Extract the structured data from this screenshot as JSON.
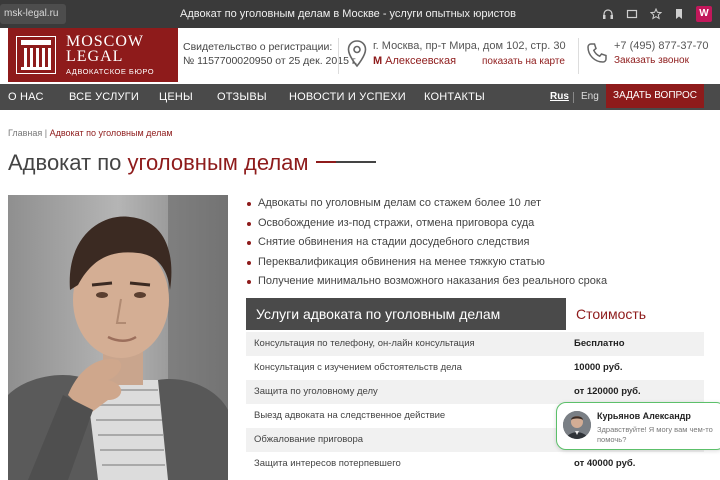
{
  "browser": {
    "url": "msk-legal.ru",
    "title": "Адвокат по уголовным делам в Москве - услуги опытных юристов",
    "extension_badge": "W"
  },
  "header": {
    "logo_line1": "MOSCOW",
    "logo_line2": "LEGAL",
    "logo_sub": "АДВОКАТСКОЕ БЮРО",
    "cert_line1": "Свидетельство о регистрации:",
    "cert_line2": "№ 1157700020950 от 25 дек. 2015 г.",
    "address": "г. Москва, пр-т Мира, дом 102, стр. 30",
    "metro_mark": "М",
    "metro": "Алексеевская",
    "map_link": "показать на карте",
    "phone": "+7 (495) 877-37-70",
    "callback": "Заказать звонок"
  },
  "nav": {
    "items": [
      "О НАС",
      "ВСЕ УСЛУГИ",
      "ЦЕНЫ",
      "ОТЗЫВЫ",
      "НОВОСТИ И УСПЕХИ",
      "КОНТАКТЫ"
    ],
    "lang_ru": "Rus",
    "lang_en": "Eng",
    "ask_button": "ЗАДАТЬ ВОПРОС"
  },
  "breadcrumb": {
    "home": "Главная",
    "sep": " | ",
    "current": "Адвокат по уголовным делам"
  },
  "heading": {
    "part1": "Адвокат по ",
    "part2": "уголовным делам"
  },
  "bullets": [
    "Адвокаты по уголовным делам со стажем более 10 лет",
    "Освобождение из-под стражи, отмена приговора суда",
    "Снятие обвинения на стадии досудебного следствия",
    "Переквалификация обвинения на менее тяжкую статью",
    "Получение минимально возможного наказания без реального срока"
  ],
  "services": {
    "title": "Услуги адвоката по уголовным делам",
    "cost_header": "Стоимость",
    "rows": [
      {
        "service": "Консультация по телефону, он-лайн консультация",
        "price": "Бесплатно"
      },
      {
        "service": "Консультация с изучением обстоятельств дела",
        "price": "10000 руб."
      },
      {
        "service": "Защита по уголовному делу",
        "price": "от 120000 руб."
      },
      {
        "service": "Выезд адвоката на следственное действие",
        "price": ""
      },
      {
        "service": "Обжалование приговора",
        "price": ""
      },
      {
        "service": "Защита интересов потерпевшего",
        "price": "от 40000 руб."
      }
    ]
  },
  "chat": {
    "name": "Курьянов Александр",
    "message": "Здравствуйте! Я могу вам чем-то помочь?"
  },
  "colors": {
    "brand": "#8e1b1b",
    "nav_bg": "#4a4a4a",
    "chat_border": "#5cc06a"
  }
}
